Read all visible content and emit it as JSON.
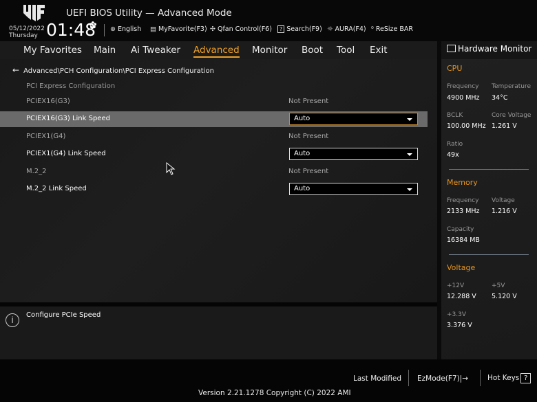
{
  "header": {
    "title": "UEFI BIOS Utility — Advanced Mode",
    "date": "05/12/2022",
    "day": "Thursday",
    "time": "01:48",
    "tools": [
      {
        "icon": "globe-icon",
        "label": "English"
      },
      {
        "icon": "favorite-list-icon",
        "label": "MyFavorite(F3)"
      },
      {
        "icon": "fan-icon",
        "label": "Qfan Control(F6)"
      },
      {
        "icon": "search-help-icon",
        "label": "Search(F9)"
      },
      {
        "icon": "aura-light-icon",
        "label": "AURA(F4)"
      },
      {
        "icon": "resize-bar-icon",
        "label": "ReSize BAR"
      }
    ]
  },
  "menu": [
    {
      "label": "My Favorites"
    },
    {
      "label": "Main"
    },
    {
      "label": "Ai Tweaker"
    },
    {
      "label": "Advanced",
      "active": true
    },
    {
      "label": "Monitor"
    },
    {
      "label": "Boot"
    },
    {
      "label": "Tool"
    },
    {
      "label": "Exit"
    }
  ],
  "breadcrumb": "Advanced\\PCH Configuration\\PCI Express Configuration",
  "section_title": "PCI Express Configuration",
  "rows": [
    {
      "label": "PCIEX16(G3)",
      "value": "Not Present"
    },
    {
      "label": "PCIEX16(G3) Link Speed",
      "dropdown": "Auto",
      "selected": true
    },
    {
      "label": "PCIEX1(G4)",
      "value": "Not Present"
    },
    {
      "label": "PCIEX1(G4) Link Speed",
      "dropdown": "Auto"
    },
    {
      "label": "M.2_2",
      "value": "Not Present"
    },
    {
      "label": "M.2_2 Link Speed",
      "dropdown": "Auto"
    }
  ],
  "help": "Configure PCIe Speed",
  "hw": {
    "title": "Hardware Monitor",
    "cpu": {
      "title": "CPU",
      "freq_k": "Frequency",
      "freq": "4900 MHz",
      "temp_k": "Temperature",
      "temp": "34°C",
      "bclk_k": "BCLK",
      "bclk": "100.00 MHz",
      "cv_k": "Core Voltage",
      "cv": "1.261 V",
      "ratio_k": "Ratio",
      "ratio": "49x"
    },
    "mem": {
      "title": "Memory",
      "freq_k": "Frequency",
      "freq": "2133 MHz",
      "volt_k": "Voltage",
      "volt": "1.216 V",
      "cap_k": "Capacity",
      "cap": "16384 MB"
    },
    "volt": {
      "title": "Voltage",
      "v12_k": "+12V",
      "v12": "12.288 V",
      "v5_k": "+5V",
      "v5": "5.120 V",
      "v33_k": "+3.3V",
      "v33": "3.376 V"
    }
  },
  "footer": {
    "last_modified": "Last Modified",
    "ezmode": "EzMode(F7)|",
    "hotkeys": "Hot Keys",
    "hotkeys_icon": "?",
    "version": "Version 2.21.1278 Copyright (C) 2022 AMI"
  },
  "colors": {
    "accent": "#f0a028",
    "highlight": "#6a6a6a"
  }
}
